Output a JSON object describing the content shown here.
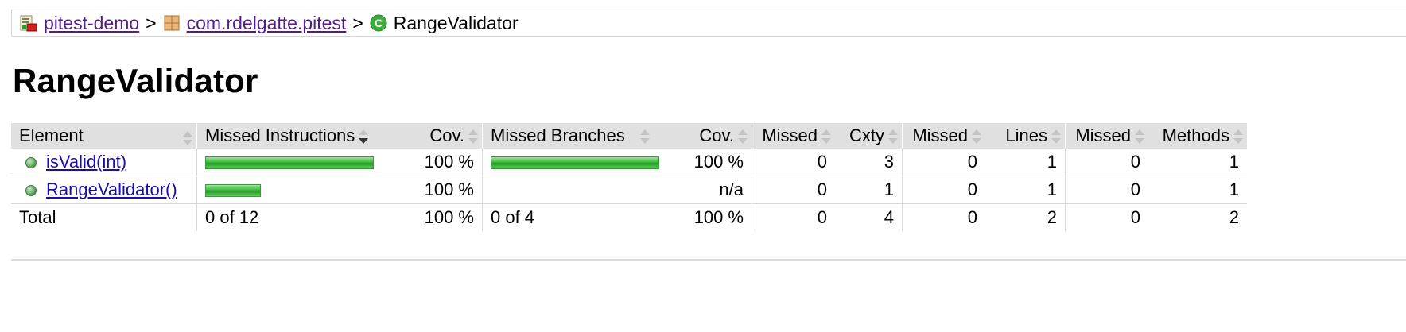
{
  "breadcrumb": {
    "project": "pitest-demo",
    "package": "com.rdelgatte.pitest",
    "class": "RangeValidator",
    "separator": ">"
  },
  "page_title": "RangeValidator",
  "table": {
    "headers": {
      "element": "Element",
      "missed_instructions": "Missed Instructions",
      "cov1": "Cov.",
      "missed_branches": "Missed Branches",
      "cov2": "Cov.",
      "missed_cxty": "Missed",
      "cxty": "Cxty",
      "missed_lines": "Missed",
      "lines": "Lines",
      "missed_methods": "Missed",
      "methods": "Methods"
    },
    "rows": [
      {
        "element": "isValid(int)",
        "instr_cov_fraction": 1.0,
        "instr_bar_weight": 1.0,
        "instr_cov": "100 %",
        "branch_cov_fraction": 1.0,
        "branch_cov": "100 %",
        "missed_cxty": "0",
        "cxty": "3",
        "missed_lines": "0",
        "lines": "1",
        "missed_methods": "0",
        "methods": "1"
      },
      {
        "element": "RangeValidator()",
        "instr_cov_fraction": 1.0,
        "instr_bar_weight": 0.33,
        "instr_cov": "100 %",
        "branch_cov": "n/a",
        "missed_cxty": "0",
        "cxty": "1",
        "missed_lines": "0",
        "lines": "1",
        "missed_methods": "0",
        "methods": "1"
      }
    ],
    "total": {
      "label": "Total",
      "instr": "0 of 12",
      "instr_cov": "100 %",
      "branch": "0 of 4",
      "branch_cov": "100 %",
      "missed_cxty": "0",
      "cxty": "4",
      "missed_lines": "0",
      "lines": "2",
      "missed_methods": "0",
      "methods": "2"
    }
  },
  "colors": {
    "link": "#551a8b",
    "element_link": "#1a0dab",
    "coverage_bar": "#3dbb3d",
    "header_bg": "#e0e0e0"
  },
  "icons": {
    "project": "report-icon",
    "package": "package-icon",
    "class": "class-icon",
    "method": "method-icon",
    "sort": "sort-icon"
  }
}
